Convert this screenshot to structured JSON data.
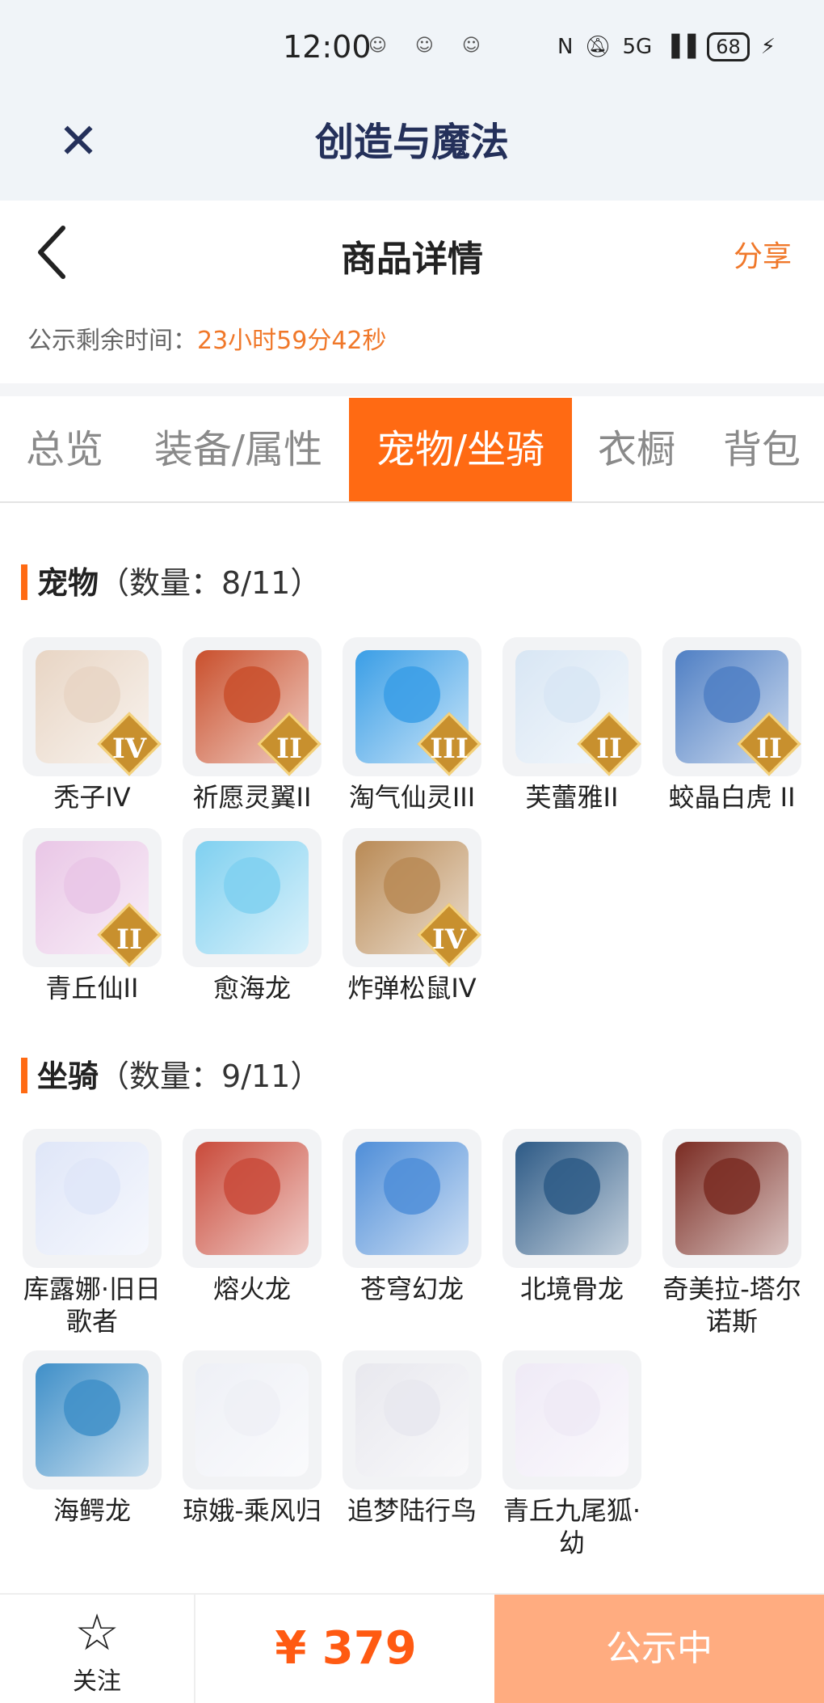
{
  "status_bar": {
    "time": "12:00",
    "emojis": "☺ ☺ ☺",
    "network": "5G",
    "battery": "68"
  },
  "app_bar": {
    "close_icon": "close-icon",
    "title": "创造与魔法"
  },
  "nav": {
    "back_icon": "back-arrow-icon",
    "title": "商品详情",
    "share": "分享"
  },
  "countdown": {
    "label": "公示剩余时间：",
    "value": "23小时59分42秒"
  },
  "tabs": [
    {
      "label": "总览",
      "active": false
    },
    {
      "label": "装备/属性",
      "active": false
    },
    {
      "label": "宠物/坐骑",
      "active": true
    },
    {
      "label": "衣橱",
      "active": false
    },
    {
      "label": "背包",
      "active": false
    }
  ],
  "pets": {
    "title": "宠物",
    "count": "（数量：8/11）",
    "items": [
      {
        "name": "秃子IV",
        "rank": "IV",
        "color": "#e8d5c4"
      },
      {
        "name": "祈愿灵翼II",
        "rank": "II",
        "color": "#c94f2c"
      },
      {
        "name": "淘气仙灵III",
        "rank": "III",
        "color": "#3a9ee6"
      },
      {
        "name": "芙蕾雅II",
        "rank": "II",
        "color": "#d8e6f4"
      },
      {
        "name": "蛟晶白虎 II",
        "rank": "II",
        "color": "#4f7fc4"
      },
      {
        "name": "青丘仙II",
        "rank": "II",
        "color": "#e9c6e6"
      },
      {
        "name": "愈海龙",
        "rank": "",
        "color": "#7fd0f0"
      },
      {
        "name": "炸弹松鼠IV",
        "rank": "IV",
        "color": "#b98a55"
      }
    ]
  },
  "mounts": {
    "title": "坐骑",
    "count": "（数量：9/11）",
    "items": [
      {
        "name": "库露娜·旧日歌者",
        "color": "#dfe6f8"
      },
      {
        "name": "熔火龙",
        "color": "#c94a3a"
      },
      {
        "name": "苍穹幻龙",
        "color": "#4f8ed8"
      },
      {
        "name": "北境骨龙",
        "color": "#2d5a86"
      },
      {
        "name": "奇美拉-塔尔诺斯",
        "color": "#7a2b22"
      },
      {
        "name": "海鳄龙",
        "color": "#3f8fc8"
      },
      {
        "name": "琼娥-乘风归",
        "color": "#eef0f6"
      },
      {
        "name": "追梦陆行鸟",
        "color": "#e8e8ee"
      },
      {
        "name": "青丘九尾狐·幼",
        "color": "#efeaf6"
      }
    ]
  },
  "bottom": {
    "follow_icon": "star-icon",
    "follow_label": "关注",
    "price": "¥ 379",
    "status_button": "公示中"
  },
  "colors": {
    "accent": "#ff6a13",
    "price": "#ff5a12",
    "button_disabled": "#ffac80",
    "title": "#24305a"
  }
}
